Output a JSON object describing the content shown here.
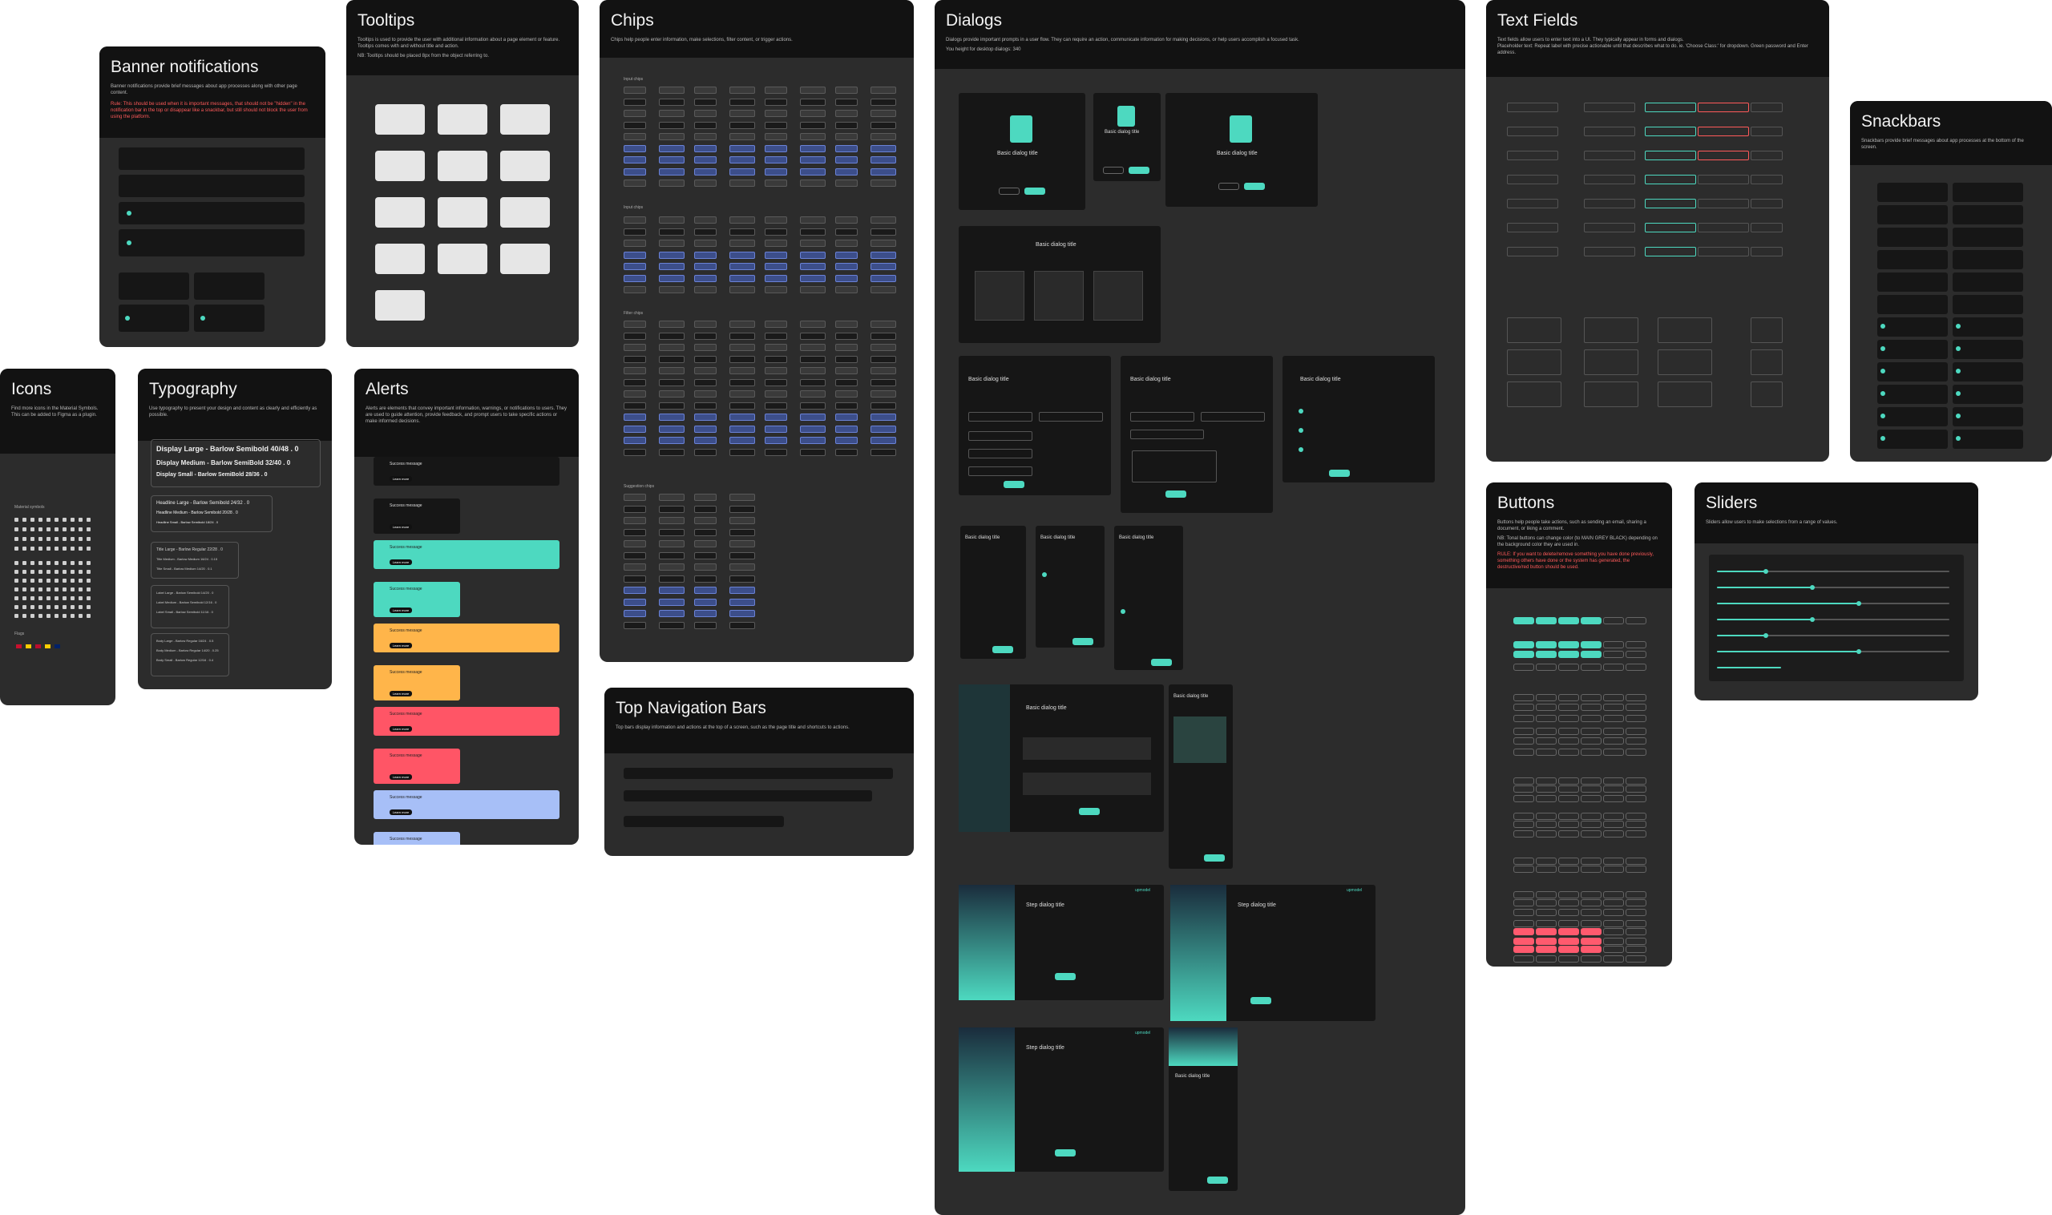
{
  "panels": {
    "banner": {
      "title": "Banner notifications",
      "desc": "Banner notifications provide brief messages about app processes along with other page content.",
      "note": "Rule: This should be used when it is important messages, that should not be \"hidden\" in the notification bar in the top or disappear like a snackbar, but still should not block the user from using the platform."
    },
    "tooltips": {
      "title": "Tooltips",
      "desc": "Tooltips is used to provide the user with additional information about a page element or feature. Tooltips comes with and without title and action.",
      "note": "NB: Tooltips should be placed 8px from the object referring to."
    },
    "chips": {
      "title": "Chips",
      "desc": "Chips help people enter information, make selections, filter content, or trigger actions.",
      "sections": [
        "Input chips",
        "Input chips",
        "Filter chips",
        "Suggestion chips"
      ]
    },
    "dialogs": {
      "title": "Dialogs",
      "desc": "Dialogs provide important prompts in a user flow. They can require an action, communicate information for making decisions, or help users accomplish a focused task.",
      "note": "You height for desktop dialogs: 340",
      "dialog_title": "Basic dialog title",
      "step_title": "Step dialog title",
      "brand": "upmodel"
    },
    "textfields": {
      "title": "Text Fields",
      "desc": "Text fields allow users to enter text into a UI. They typically appear in forms and dialogs.",
      "note": "Placeholder text: Repeat label with precise actionable until that describes what to do. ie. 'Choose Class:' for dropdown. Green password and Enter address."
    },
    "snackbars": {
      "title": "Snackbars",
      "desc": "Snackbars provide brief messages about app processes at the bottom of the screen."
    },
    "icons": {
      "title": "Icons",
      "desc": "Find more icons in the Material Symbols. This can be added to Figma as a plugin.",
      "section1": "Material symbols",
      "section2": "Flags"
    },
    "typography": {
      "title": "Typography",
      "desc": "Use typography to present your design and content as clearly and efficiently as possible.",
      "display": [
        "Display Large - Barlow Semibold 40/48 . 0",
        "Display Medium - Barlow SemiBold 32/40 . 0",
        "Display Small - Barlow SemiBold 28/36 . 0"
      ],
      "headline": [
        "Headline Large - Barlow Semibold 24/32 . 0",
        "Headline Medium - Barlow Semibold 20/28 . 0",
        "Headline Small - Barlow Semibold 18/24 . 0"
      ],
      "titles": [
        "Title Large - Barlow Regular 22/28 . 0",
        "Title Medium - Barlow Medium 16/24 . 0.15",
        "Title Small - Barlow Medium 14/20 . 0.1"
      ],
      "labels": [
        "Label Large - Barlow Semibold 14/20 . 0",
        "Label Medium - Barlow Semibold 12/16 . 0",
        "Label Small - Barlow Semibold 11/16 . 0"
      ],
      "body": [
        "Body Large - Barlow Regular 16/24 . 0.5",
        "Body Medium - Barlow Regular 14/20 . 0.25",
        "Body Small - Barlow Regular 12/16 . 0.4"
      ]
    },
    "alerts": {
      "title": "Alerts",
      "desc": "Alerts are elements that convey important information, warnings, or notifications to users. They are used to guide attention, provide feedback, and prompt users to take specific actions or make informed decisions.",
      "item": "Success message",
      "action": "Learn more"
    },
    "topnav": {
      "title": "Top Navigation Bars",
      "desc": "Top bars display information and actions at the top of a screen, such as the page title and shortcuts to actions."
    },
    "buttons": {
      "title": "Buttons",
      "desc": "Buttons help people take actions, such as sending an email, sharing a document, or liking a comment.",
      "note1": "NB: Tonal buttons can change color (to MAIN GREY BLACK) depending on the background color they are used in.",
      "note2": "RULE: If you want to delete/remove something you have done previously, something others have done or the system has generated, the destructive/red button should be used."
    },
    "sliders": {
      "title": "Sliders",
      "desc": "Sliders allow users to make selections from a range of values."
    }
  },
  "colors": {
    "panel": "#2c2c2c",
    "header": "#121212",
    "accent": "#4dd9c0",
    "orange": "#ffb54a",
    "red": "#ff5566",
    "blue": "#a7bff7"
  }
}
